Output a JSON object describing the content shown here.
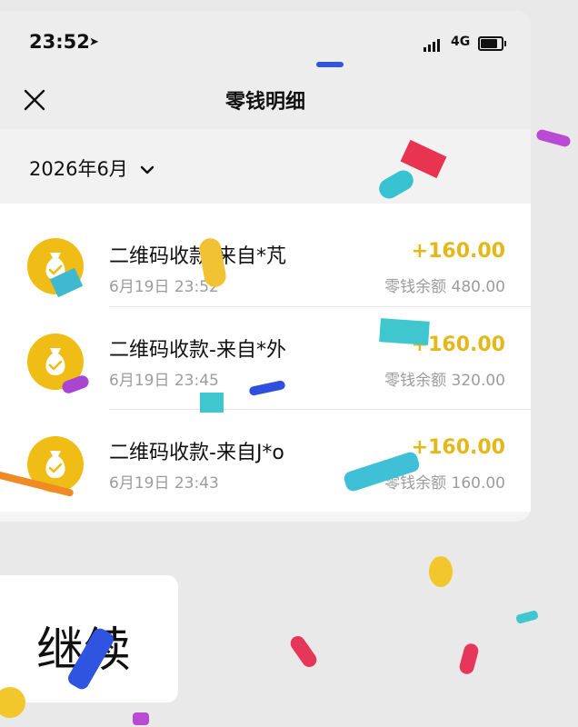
{
  "status": {
    "time": "23:52",
    "network": "4G"
  },
  "nav": {
    "title": "零钱明细"
  },
  "month": {
    "label": "2026年6月"
  },
  "transactions": [
    {
      "title": "二维码收款-来自*芃",
      "time": "6月19日 23:52",
      "amount": "+160.00",
      "balance": "零钱余额 480.00"
    },
    {
      "title": "二维码收款-来自*外",
      "time": "6月19日 23:45",
      "amount": "+160.00",
      "balance": "零钱余额 320.00"
    },
    {
      "title": "二维码收款-来自J*o",
      "time": "6月19日 23:43",
      "amount": "+160.00",
      "balance": "零钱余额 160.00"
    }
  ],
  "continue": {
    "label": "继续"
  },
  "colors": {
    "coin": "#f0bd16",
    "amount": "#e4b71a"
  }
}
